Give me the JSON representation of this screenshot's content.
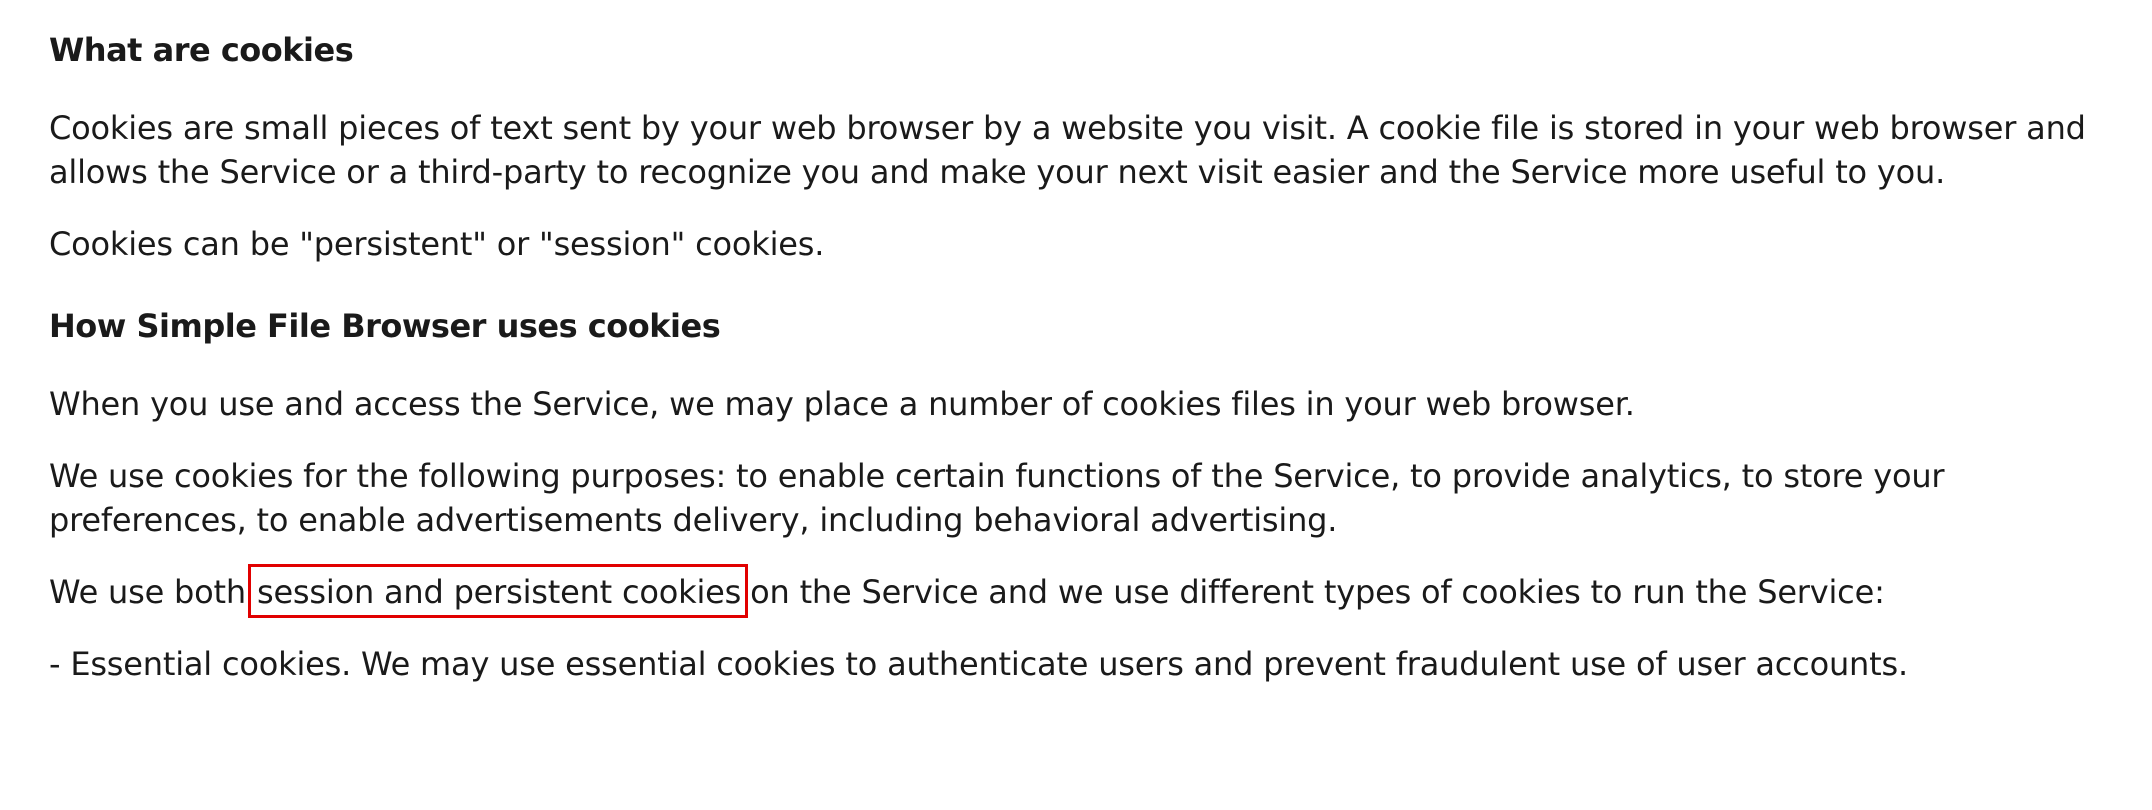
{
  "sections": {
    "what_heading": "What are cookies",
    "what_p1": "Cookies are small pieces of text sent by your web browser by a website you visit. A cookie file is stored in your web browser and allows the Service or a third-party to recognize you and make your next visit easier and the Service more useful to you.",
    "what_p2": "Cookies can be \"persistent\" or \"session\" cookies.",
    "how_heading": "How Simple File Browser uses cookies",
    "how_p1": "When you use and access the Service, we may place a number of cookies files in your web browser.",
    "how_p2": "We use cookies for the following purposes: to enable certain functions of the Service, to provide analytics, to store your preferences, to enable advertisements delivery, including behavioral advertising.",
    "how_p3_before": "We use both",
    "how_p3_highlight": "session and persistent cookies",
    "how_p3_after": "on the Service and we use different types of cookies to run the Service:",
    "how_p4": "- Essential cookies. We may use essential cookies to authenticate users and prevent fraudulent use of user accounts."
  },
  "colors": {
    "text": "#1a1a1a",
    "highlight_border": "#e10000",
    "background": "#ffffff"
  }
}
